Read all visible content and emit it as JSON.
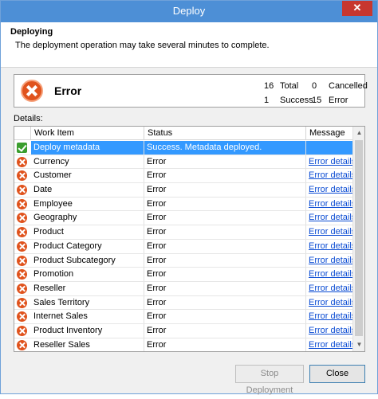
{
  "window": {
    "title": "Deploy",
    "close_glyph": "✕"
  },
  "header": {
    "title": "Deploying",
    "description": "The deployment operation may take several minutes to complete."
  },
  "status": {
    "icon": "error-icon",
    "label": "Error",
    "total_count": "16",
    "total_label": "Total",
    "cancelled_count": "0",
    "cancelled_label": "Cancelled",
    "success_count": "1",
    "success_label": "Success",
    "error_count": "15",
    "error_label": "Error"
  },
  "details_label": "Details:",
  "grid": {
    "columns": {
      "work_item": "Work Item",
      "status": "Status",
      "message": "Message"
    },
    "rows": [
      {
        "icon": "check-icon",
        "item": "Deploy metadata",
        "status": "Success. Metadata deployed.",
        "message": "",
        "selected": true
      },
      {
        "icon": "error-icon",
        "item": "Currency",
        "status": "Error",
        "message": "Error details"
      },
      {
        "icon": "error-icon",
        "item": "Customer",
        "status": "Error",
        "message": "Error details"
      },
      {
        "icon": "error-icon",
        "item": "Date",
        "status": "Error",
        "message": "Error details"
      },
      {
        "icon": "error-icon",
        "item": "Employee",
        "status": "Error",
        "message": "Error details"
      },
      {
        "icon": "error-icon",
        "item": "Geography",
        "status": "Error",
        "message": "Error details"
      },
      {
        "icon": "error-icon",
        "item": "Product",
        "status": "Error",
        "message": "Error details"
      },
      {
        "icon": "error-icon",
        "item": "Product Category",
        "status": "Error",
        "message": "Error details"
      },
      {
        "icon": "error-icon",
        "item": "Product Subcategory",
        "status": "Error",
        "message": "Error details"
      },
      {
        "icon": "error-icon",
        "item": "Promotion",
        "status": "Error",
        "message": "Error details"
      },
      {
        "icon": "error-icon",
        "item": "Reseller",
        "status": "Error",
        "message": "Error details"
      },
      {
        "icon": "error-icon",
        "item": "Sales Territory",
        "status": "Error",
        "message": "Error details"
      },
      {
        "icon": "error-icon",
        "item": "Internet Sales",
        "status": "Error",
        "message": "Error details"
      },
      {
        "icon": "error-icon",
        "item": "Product Inventory",
        "status": "Error",
        "message": "Error details"
      },
      {
        "icon": "error-icon",
        "item": "Reseller Sales",
        "status": "Error",
        "message": "Error details"
      }
    ]
  },
  "buttons": {
    "stop": "Stop Deployment",
    "close": "Close"
  },
  "colors": {
    "titlebar": "#4d8fd6",
    "selection": "#3399ff",
    "error": "#e0531d",
    "success": "#3b9e2e",
    "link": "#0b4cd3"
  }
}
